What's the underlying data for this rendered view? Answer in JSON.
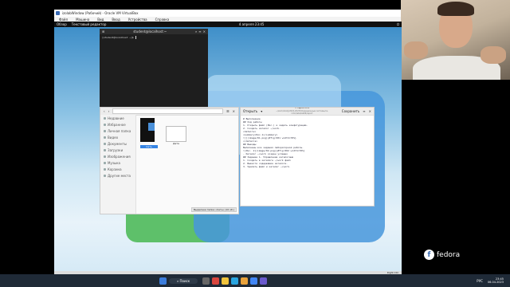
{
  "host": {
    "window_title": "izolabWindow (Рабочий) - Oracle VM VirtualBox",
    "menu": [
      "Файл",
      "Машина",
      "Вид",
      "Ввод",
      "Устройства",
      "Справка"
    ],
    "status_text": "Right Ctrl"
  },
  "guest_topbar": {
    "activities": "Обзор",
    "app": "Текстовый редактор",
    "clock": "4 апреля 23:45"
  },
  "terminal": {
    "title": "student@localhost:~",
    "prompt": "[student@localhost ~]$ "
  },
  "files": {
    "sidebar": [
      "Недавние",
      "Избранное",
      "Личная папка",
      "Видео",
      "Документы",
      "Загрузки",
      "Изображения",
      "Музыка",
      "Корзина",
      "Другие места"
    ],
    "items": [
      {
        "label": "Сеть"
      },
      {
        "label": "Дата"
      }
    ],
    "status": "Выделена папка «Сеть» (10 об.)"
  },
  "editor": {
    "open_label": "Открыть",
    "title": "~ report.md",
    "subtitle": "~/work/study/2022-2023/Операционные системы/os-intro/labs/lab06/report",
    "save_label": "Сохранить",
    "lines": [
      "# Выполнение",
      "",
      "## Ход работы",
      "1. Открыть файл (Рис.) и задать конфигурацию.",
      "2. Создать каталог ~/work.",
      "",
      "<details>",
      "  <summary>Рис.1</summary>",
      "  ![](image/01.png){#fig:001 width=70%}",
      "</details>",
      "",
      "## Выводы",
      "",
      "Выполнены все задания лабораторной работы.",
      "",
      "",
      "![Рис. 2](image/02.png){#fig:002 width=70%}",
      "",
      "- Каталог ~/work создан успешно",
      "",
      "## Задание 1. Управление каталогами",
      "",
      "1. Создать в каталоге ~/work файл",
      "2. Вывести содержимое каталога.",
      "3. Удалить файл и каталог ~/work."
    ]
  },
  "taskbar": {
    "search": "Поиск",
    "time": "23:45",
    "date": "06.04.2023",
    "lang": "РУС"
  },
  "fedora_logo_text": "fedora"
}
